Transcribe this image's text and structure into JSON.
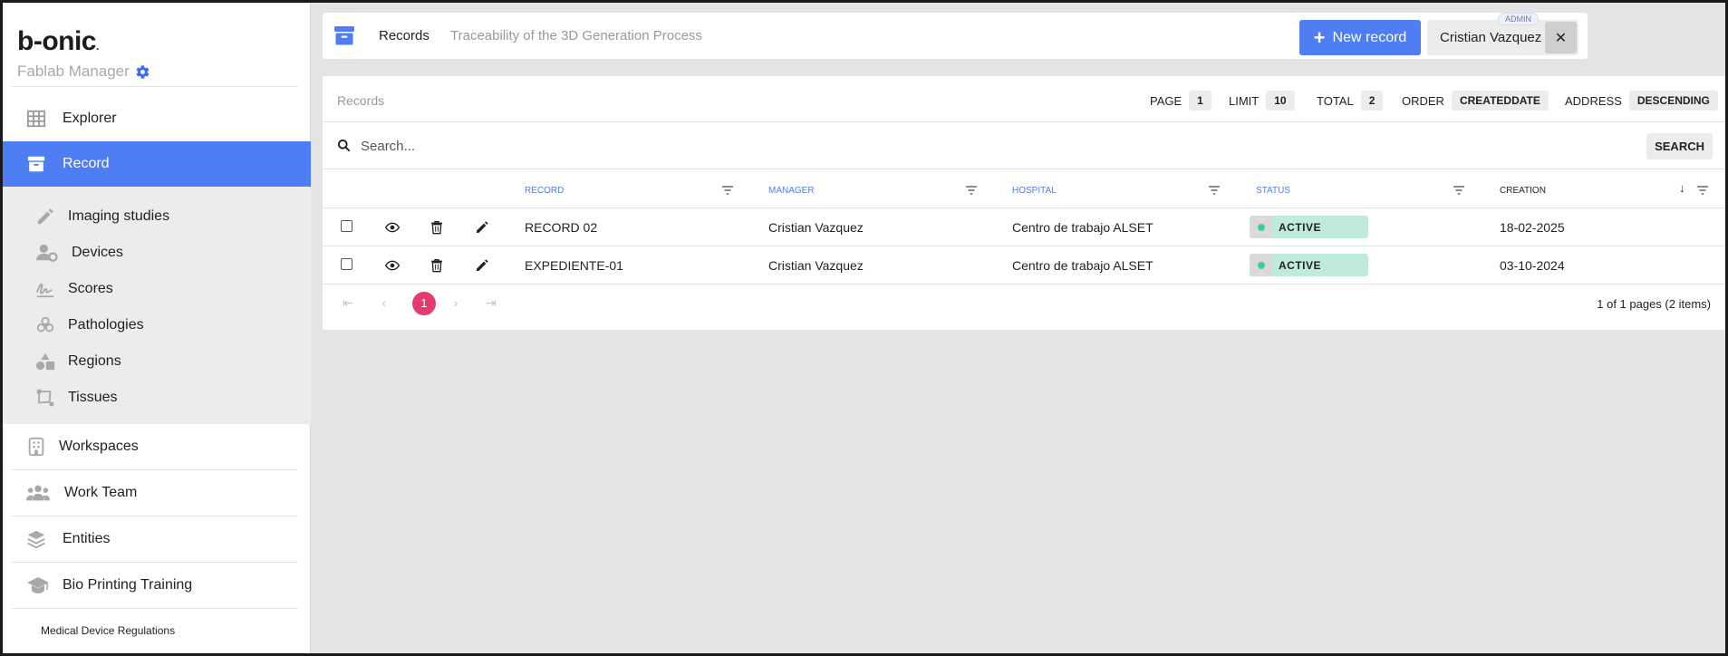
{
  "brand": {
    "logo": "b-onic",
    "logo_dot": ".",
    "subtitle": "Fablab Manager"
  },
  "sidebar": {
    "items": [
      {
        "label": "Explorer"
      },
      {
        "label": "Record"
      },
      {
        "label": "Workspaces"
      },
      {
        "label": "Work Team"
      },
      {
        "label": "Entities"
      },
      {
        "label": "Bio Printing Training"
      }
    ],
    "submenu": [
      {
        "label": "Imaging studies"
      },
      {
        "label": "Devices"
      },
      {
        "label": "Scores"
      },
      {
        "label": "Pathologies"
      },
      {
        "label": "Regions"
      },
      {
        "label": "Tissues"
      }
    ],
    "footer_link": "Medical Device Regulations"
  },
  "header": {
    "crumb": "Records",
    "description": "Traceability of the 3D Generation Process",
    "new_button": "New record",
    "user_name": "Cristian Vazquez",
    "user_role": "ADMIN",
    "close_label": "✕"
  },
  "panel": {
    "title": "Records",
    "meta": {
      "page_label": "PAGE",
      "page": "1",
      "limit_label": "LIMIT",
      "limit": "10",
      "total_label": "TOTAL",
      "total": "2",
      "order_label": "ORDER",
      "order": "CREATEDDATE",
      "address_label": "ADDRESS",
      "address": "DESCENDING"
    },
    "search": {
      "placeholder": "Search...",
      "button": "SEARCH"
    },
    "columns": [
      "RECORD",
      "MANAGER",
      "HOSPITAL",
      "STATUS",
      "CREATION"
    ],
    "sort_arrow": "↓",
    "rows": [
      {
        "record": "RECORD 02",
        "manager": "Cristian Vazquez",
        "hospital": "Centro de trabajo ALSET",
        "status": "ACTIVE",
        "creation": "18-02-2025"
      },
      {
        "record": "EXPEDIENTE-01",
        "manager": "Cristian Vazquez",
        "hospital": "Centro de trabajo ALSET",
        "status": "ACTIVE",
        "creation": "03-10-2024"
      }
    ],
    "pagination": {
      "current": "1",
      "info": "1 of 1 pages (2 items)"
    }
  },
  "colors": {
    "accent": "#4f7df3",
    "active_status": "#bfeadd",
    "pager_current": "#e33b6f"
  }
}
